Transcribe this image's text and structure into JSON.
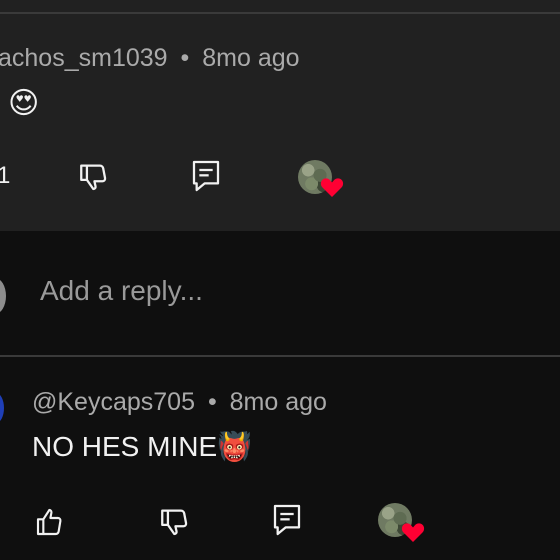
{
  "comment1": {
    "username": "achos_sm1039",
    "separator": "•",
    "time": "8mo ago",
    "text": "😍",
    "like_count": "1"
  },
  "reply": {
    "placeholder": "Add a reply..."
  },
  "comment2": {
    "username": "@Keycaps705",
    "separator": "•",
    "time": "8mo ago",
    "text": "NO HES MINE👹"
  },
  "colors": {
    "background": "#0f0f0f",
    "highlight_card": "#212121",
    "heart": "#ff0033",
    "meta_text": "#aaaaaa"
  },
  "icons": [
    "thumbs-down-icon",
    "reply-icon",
    "creator-heart-icon",
    "thumbs-up-icon"
  ]
}
